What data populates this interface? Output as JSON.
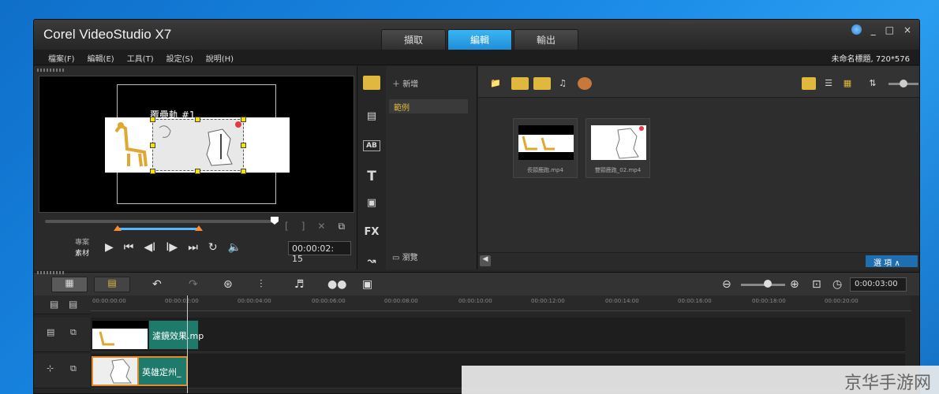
{
  "app": {
    "title": "Corel VideoStudio X7",
    "tabs": [
      {
        "label": "擷取",
        "active": false
      },
      {
        "label": "編輯",
        "active": true
      },
      {
        "label": "輸出",
        "active": false
      }
    ],
    "window_controls": [
      "_",
      "□",
      "×"
    ]
  },
  "menu": {
    "items": [
      "檔案(F)",
      "編輯(E)",
      "工具(T)",
      "設定(S)",
      "說明(H)"
    ],
    "project_info": "未命名標題, 720*576"
  },
  "preview": {
    "overlay_label": "覆疊軌 #1",
    "mode_labels": [
      "專案",
      "素材"
    ],
    "timecode": "00:00:02: 15",
    "mark_buttons": [
      "[",
      "]"
    ]
  },
  "library": {
    "add_label": "新增",
    "category": "範例",
    "browse_label": "瀏覽",
    "thumbnails": [
      {
        "caption": "長頸鹿跑.mp4"
      },
      {
        "caption": "雙頸鹿跑_02.mp4"
      }
    ],
    "options_label": "選 項",
    "left_icons": [
      "media-icon",
      "transition-icon",
      "title-ab-icon",
      "text-T-icon",
      "graphic-icon",
      "FX",
      "path-icon"
    ]
  },
  "timeline": {
    "time_display": "0:00:03:00",
    "ruler_ticks": [
      "00:00:00:00",
      "00:00:02:00",
      "00:00:04:00",
      "00:00:06:00",
      "00:00:08:00",
      "00:00:10:00",
      "00:00:12:00",
      "00:00:14:00",
      "00:00:16:00",
      "00:00:18:00",
      "00:00:20:00"
    ],
    "video_clip_label": "濾鏡效果.mp",
    "overlay_clip_label": "英雄定州_"
  },
  "watermark": "京华手游网",
  "colors": {
    "accent_blue": "#1f8fd8",
    "clip_green": "#1e7a6a",
    "clip_orange": "#e08a2a",
    "handle_yellow": "#f4e200"
  }
}
